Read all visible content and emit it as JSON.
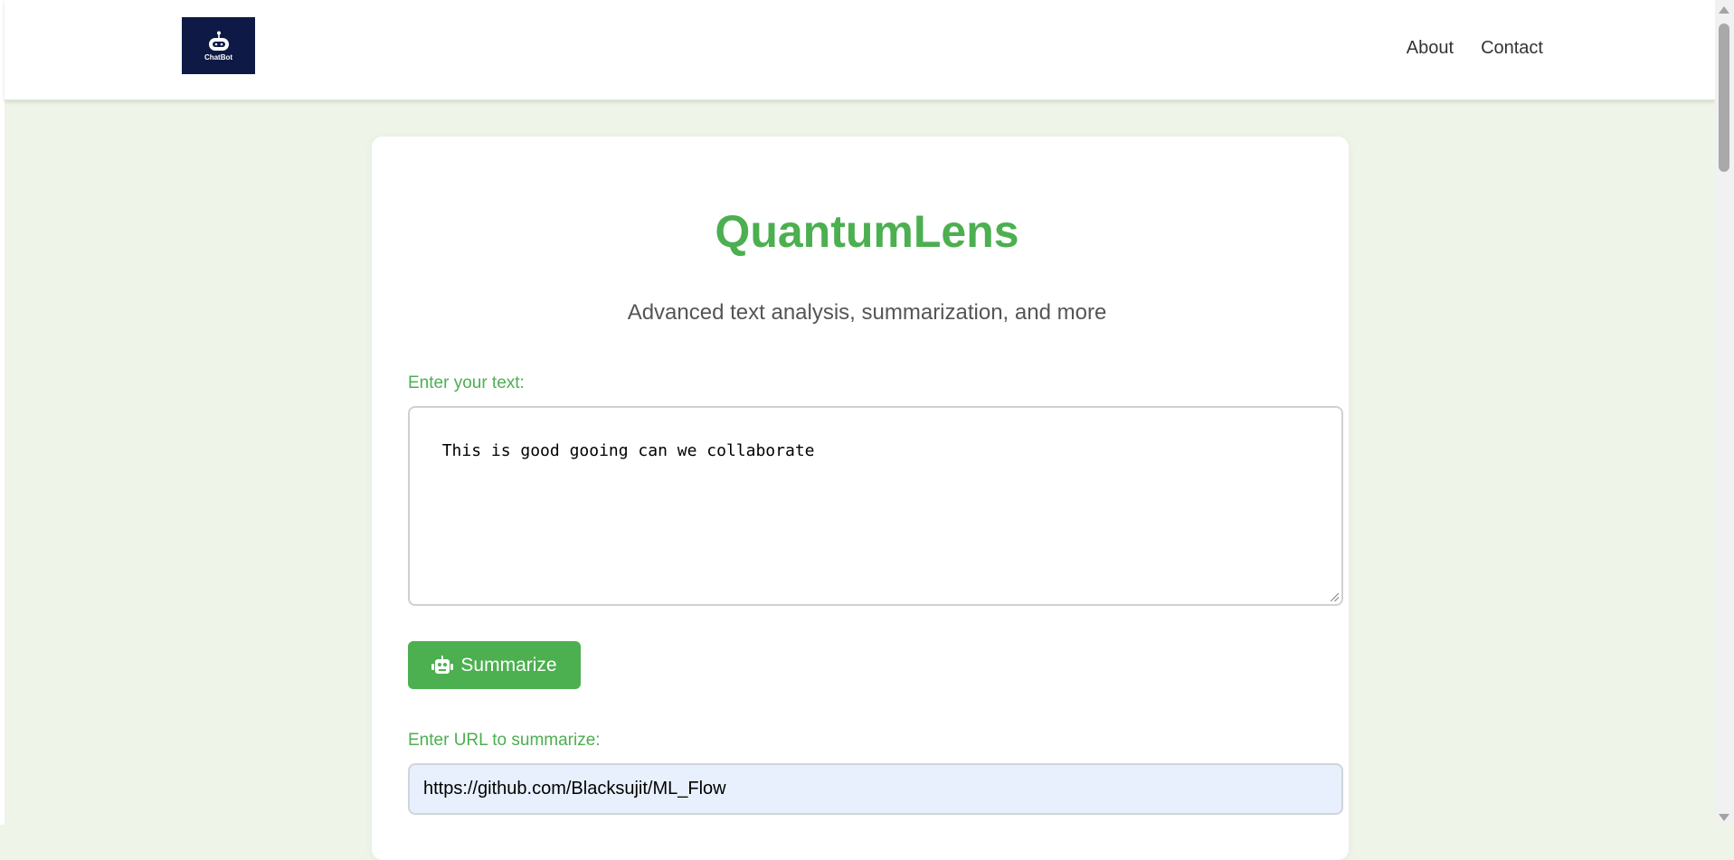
{
  "header": {
    "logo_text": "ChatBot",
    "nav": [
      {
        "label": "About"
      },
      {
        "label": "Contact"
      }
    ]
  },
  "main": {
    "title": "QuantumLens",
    "subtitle": "Advanced text analysis, summarization, and more",
    "text_label": "Enter your text:",
    "text_value": "This is good gooing can we collaborate",
    "summarize_label": "Summarize",
    "url_label": "Enter URL to summarize:",
    "url_value": "https://github.com/Blacksujit/ML_Flow"
  },
  "icons": {
    "logo": "robot-icon",
    "button": "robot-icon"
  },
  "colors": {
    "accent": "#4caf50",
    "page_background": "#eef5e8",
    "logo_background": "#0e1a45",
    "url_field_background": "#e8f0fe"
  }
}
